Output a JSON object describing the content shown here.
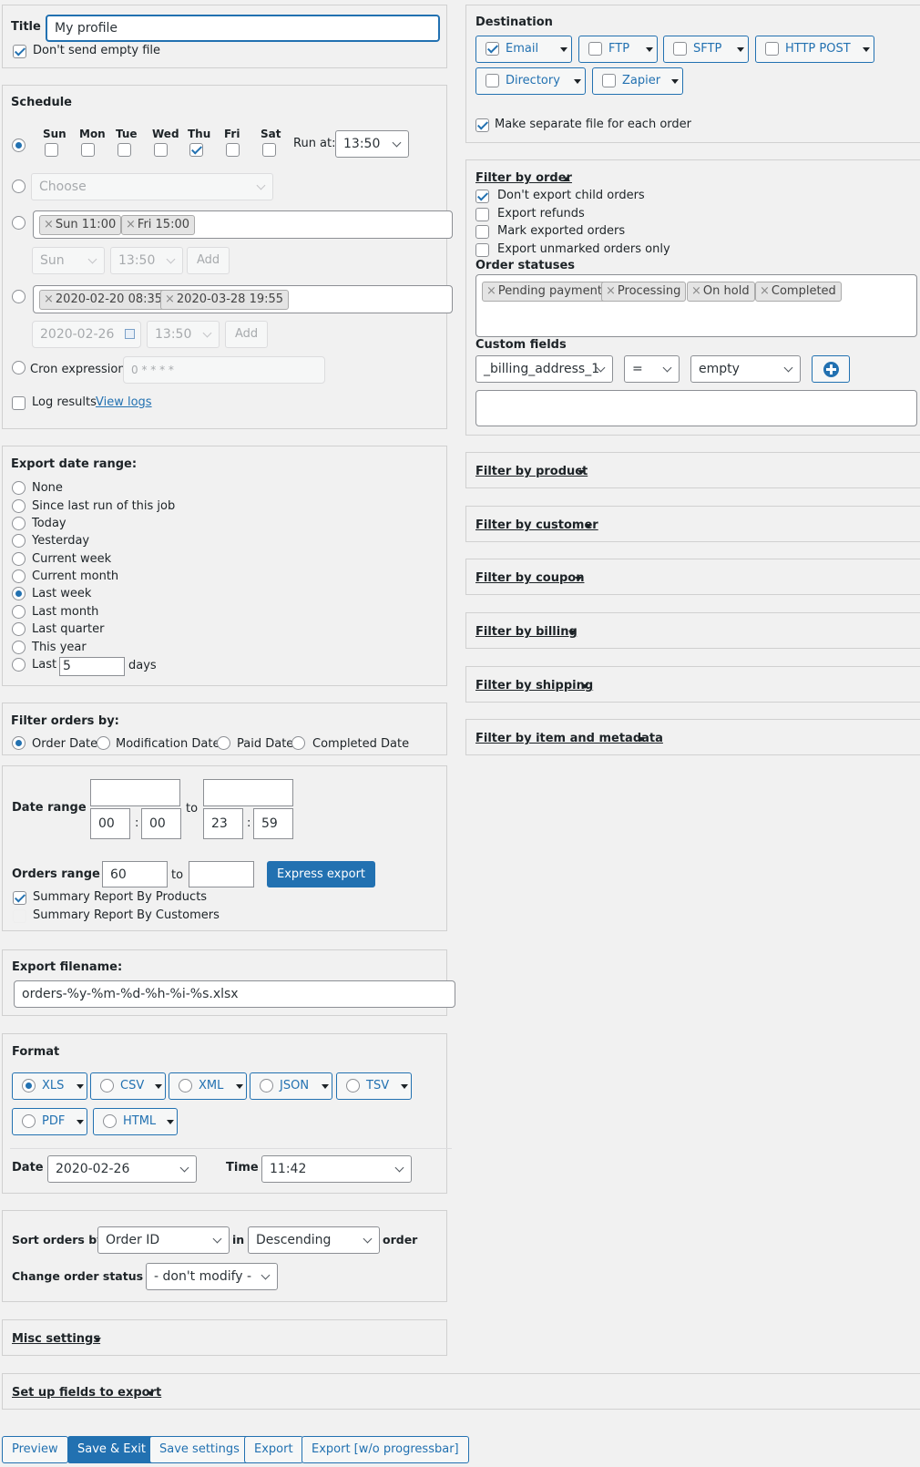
{
  "title": {
    "label": "Title",
    "value": "My profile",
    "dont_send_empty": "Don't send empty file",
    "dont_send_empty_checked": true
  },
  "schedule": {
    "heading": "Schedule",
    "days": [
      "Sun",
      "Mon",
      "Tue",
      "Wed",
      "Thu",
      "Fri",
      "Sat"
    ],
    "days_checked": [
      false,
      false,
      false,
      false,
      true,
      false,
      false
    ],
    "run_at_label": "Run at:",
    "run_at_value": "13:50",
    "choose_placeholder": "Choose",
    "weekly_tags": [
      "Sun 11:00",
      "Fri 15:00"
    ],
    "weekly_day": "Sun",
    "weekly_time": "13:50",
    "add_label": "Add",
    "date_tags": [
      "2020-02-20 08:35",
      "2020-03-28 19:55"
    ],
    "date_value": "2020-02-26",
    "date_time": "13:50",
    "cron_label": "Cron expression:",
    "cron_value": "0 * * * *",
    "log_results": "Log results",
    "view_logs": "View logs"
  },
  "export_date_range": {
    "heading": "Export date range:",
    "options": [
      "None",
      "Since last run of this job",
      "Today",
      "Yesterday",
      "Current week",
      "Current month",
      "Last week",
      "Last month",
      "Last quarter",
      "This year",
      "Last"
    ],
    "selected": "Last week",
    "last_days_value": "5",
    "days_label": "days"
  },
  "filter_orders_by": {
    "heading": "Filter orders by:",
    "options": [
      "Order Date",
      "Modification Date",
      "Paid Date",
      "Completed Date"
    ],
    "selected": "Order Date"
  },
  "date_range": {
    "label": "Date range",
    "to": "to",
    "from_hour": "00",
    "from_min": "00",
    "to_hour": "23",
    "to_min": "59",
    "sep": ":"
  },
  "orders_range": {
    "label": "Orders range",
    "from": "60",
    "to": "to",
    "express_export": "Express export",
    "summary_products": "Summary Report By Products",
    "summary_products_checked": true,
    "summary_customers": "Summary Report By Customers"
  },
  "export_filename": {
    "heading": "Export filename:",
    "value": "orders-%y-%m-%d-%h-%i-%s.xlsx"
  },
  "format": {
    "heading": "Format",
    "options": [
      "XLS",
      "CSV",
      "XML",
      "JSON",
      "TSV",
      "PDF",
      "HTML"
    ],
    "selected": "XLS",
    "date_label": "Date",
    "date_value": "2020-02-26",
    "time_label": "Time",
    "time_value": "11:42"
  },
  "sort": {
    "sort_label": "Sort orders by",
    "sort_value": "Order ID",
    "in": "in",
    "direction": "Descending",
    "order": "order",
    "status_label": "Change order status to",
    "status_value": "- don't modify -"
  },
  "misc": {
    "label": "Misc settings"
  },
  "fields": {
    "label": "Set up fields to export"
  },
  "buttons": {
    "preview": "Preview",
    "save_exit": "Save & Exit",
    "save_settings": "Save settings",
    "export": "Export",
    "export_no_progress": "Export [w/o progressbar]"
  },
  "destination": {
    "heading": "Destination",
    "options": [
      "Email",
      "FTP",
      "SFTP",
      "HTTP POST",
      "Directory",
      "Zapier"
    ],
    "checked": [
      true,
      false,
      false,
      false,
      false,
      false
    ],
    "separate_file": "Make separate file for each order",
    "separate_file_checked": true
  },
  "filter_by_order": {
    "label": "Filter by order",
    "checks": [
      "Don't export child orders",
      "Export refunds",
      "Mark exported orders",
      "Export unmarked orders only"
    ],
    "checked": [
      true,
      false,
      false,
      false
    ],
    "statuses_label": "Order statuses",
    "statuses": [
      "Pending payment",
      "Processing",
      "On hold",
      "Completed"
    ],
    "custom_fields_label": "Custom fields",
    "cf_field": "_billing_address_1",
    "cf_op": "=",
    "cf_value": "empty"
  },
  "filters": [
    "Filter by product",
    "Filter by customer",
    "Filter by coupon",
    "Filter by billing",
    "Filter by shipping",
    "Filter by item and metadata"
  ],
  "colors": {
    "accent": "#2271b1",
    "panel_border": "#d0d0d0",
    "background": "#f1f1f1"
  }
}
